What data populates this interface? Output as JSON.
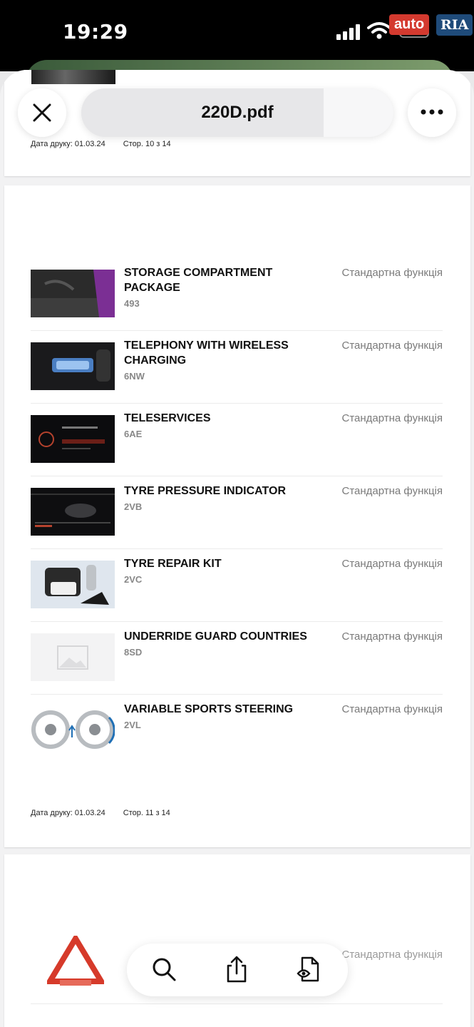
{
  "status_bar": {
    "time": "19:29"
  },
  "watermark": {
    "part1": "auto",
    "part2": "RIA"
  },
  "header": {
    "title": "220D.pdf"
  },
  "pages": [
    {
      "footer": {
        "print_date": "Дата друку: 01.03.24",
        "page": "Стор. 10 з 14"
      }
    },
    {
      "footer": {
        "print_date": "Дата друку: 01.03.24",
        "page": "Стор. 11 з 14"
      }
    }
  ],
  "items": [
    {
      "title": "STORAGE COMPARTMENT PACKAGE",
      "code": "493",
      "status": "Стандартна функція"
    },
    {
      "title": "TELEPHONY WITH WIRELESS CHARGING",
      "code": "6NW",
      "status": "Стандартна функція"
    },
    {
      "title": "TELESERVICES",
      "code": "6AE",
      "status": "Стандартна функція"
    },
    {
      "title": "TYRE PRESSURE INDICATOR",
      "code": "2VB",
      "status": "Стандартна функція"
    },
    {
      "title": "TYRE REPAIR KIT",
      "code": "2VC",
      "status": "Стандартна функція"
    },
    {
      "title": "UNDERRIDE GUARD COUNTRIES",
      "code": "8SD",
      "status": "Стандартна функція"
    },
    {
      "title": "VARIABLE SPORTS STEERING",
      "code": "2VL",
      "status": "Стандартна функція"
    }
  ],
  "partial_item": {
    "status": "Стандартна функція"
  },
  "toolbar_icons": [
    "search-icon",
    "share-icon",
    "document-view-icon"
  ],
  "colors": {
    "text": "#111111",
    "muted": "#7a7a7a",
    "background": "#f2f2f3",
    "watermark_red": "#d43a2f",
    "watermark_blue": "#1f4b7a"
  }
}
